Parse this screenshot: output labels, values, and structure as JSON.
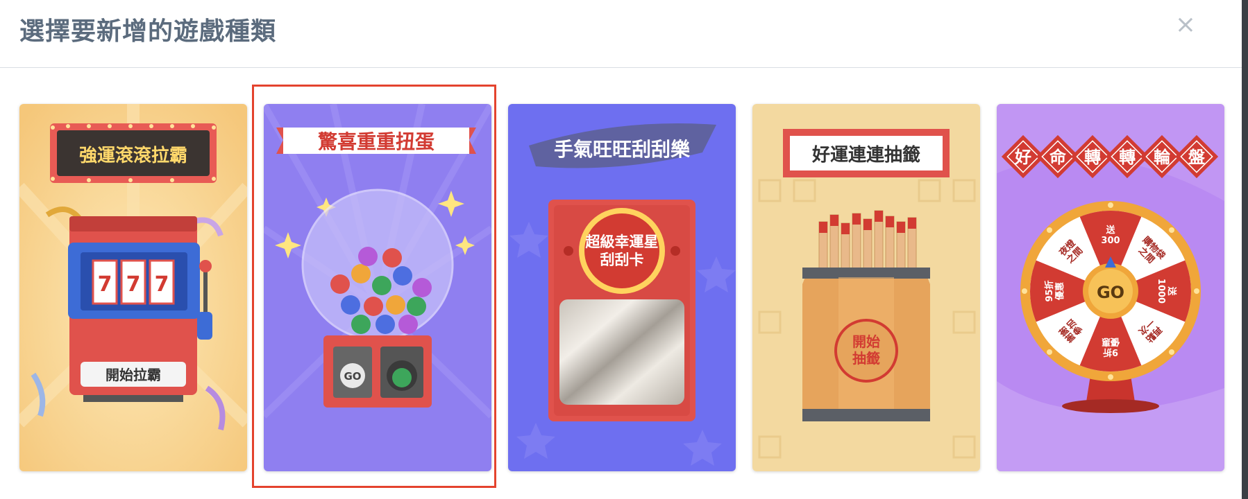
{
  "dialog": {
    "title": "選擇要新增的遊戲種類",
    "close_label": "×"
  },
  "games": [
    {
      "title": "強運滾滾拉霸",
      "reel_digits": [
        "7",
        "7",
        "7"
      ],
      "action_label": "開始拉霸"
    },
    {
      "title": "驚喜重重扭蛋",
      "go_label": "GO",
      "selected": true
    },
    {
      "title": "手氣旺旺刮刮樂",
      "badge_line1": "超級幸運星",
      "badge_line2": "刮刮卡"
    },
    {
      "title": "好運連連抽籤",
      "action_line1": "開始",
      "action_line2": "抽籤"
    },
    {
      "title_chars": [
        "好",
        "命",
        "轉",
        "轉",
        "輪",
        "盤"
      ],
      "go_label": "GO",
      "wheel_segments": [
        "送\n300",
        "購物袋\n之間",
        "送\n1000",
        "再點\n一次",
        "9折\n優惠",
        "謝謝\n參加",
        "95折\n優惠",
        "夜燈\n之間"
      ]
    }
  ],
  "colors": {
    "selection_border": "#e4432e",
    "slot_bg": "#f7d08a",
    "gacha_bg": "#8f7ff0",
    "scratch_bg": "#6e6ff0",
    "lots_bg": "#f3d9a0",
    "wheel_bg": "#b98af2",
    "red": "#d23b32"
  }
}
